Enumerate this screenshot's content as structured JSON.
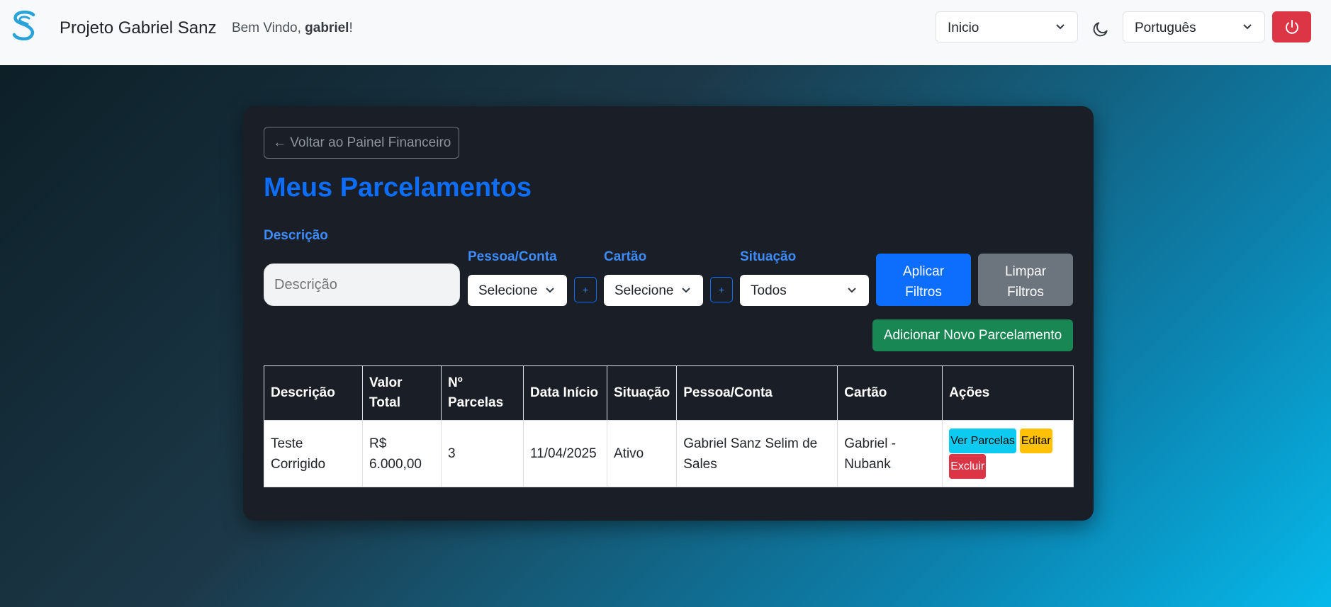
{
  "header": {
    "brand": "Projeto Gabriel Sanz",
    "welcome_prefix": "Bem Vindo, ",
    "username": "gabriel",
    "welcome_suffix": "!",
    "nav_select": "Inicio",
    "language_select": "Português",
    "icons": [
      "logo-s-icon",
      "chevron-down-icon",
      "moon-icon",
      "power-icon"
    ]
  },
  "page": {
    "back_label": "← Voltar ao Painel Financeiro",
    "title": "Meus Parcelamentos"
  },
  "filters": {
    "desc_label": "Descrição",
    "desc_placeholder": "Descrição",
    "pessoa_label": "Pessoa/Conta",
    "pessoa_value": "Selecione",
    "cartao_label": "Cartão",
    "cartao_value": "Selecione",
    "situacao_label": "Situação",
    "situacao_value": "Todos",
    "plus": "+",
    "apply_line1": "Aplicar",
    "apply_line2": "Filtros",
    "clear_line1": "Limpar",
    "clear_line2": "Filtros",
    "add_label": "Adicionar Novo Parcelamento"
  },
  "table": {
    "headers": {
      "descricao": "Descrição",
      "valor_l1": "Valor",
      "valor_l2": "Total",
      "parcelas_l1": "Nº",
      "parcelas_l2": "Parcelas",
      "data": "Data Início",
      "situacao": "Situação",
      "pessoa": "Pessoa/Conta",
      "cartao": "Cartão",
      "acoes": "Ações"
    },
    "rows": [
      {
        "descricao": "Teste Corrigido",
        "valor": "R$ 6.000,00",
        "parcelas": "3",
        "data": "11/04/2025",
        "situacao": "Ativo",
        "pessoa": "Gabriel Sanz Selim de Sales",
        "cartao": "Gabriel - Nubank",
        "acao_ver": "Ver Parcelas",
        "acao_editar": "Editar",
        "acao_excluir": "Excluir"
      }
    ]
  },
  "colors": {
    "primary": "#0d6efd",
    "success": "#198754",
    "danger": "#dc3545",
    "secondary": "#6c757d",
    "info": "#0dcaf0",
    "warning": "#ffc107",
    "card_bg": "#1a1e26"
  }
}
